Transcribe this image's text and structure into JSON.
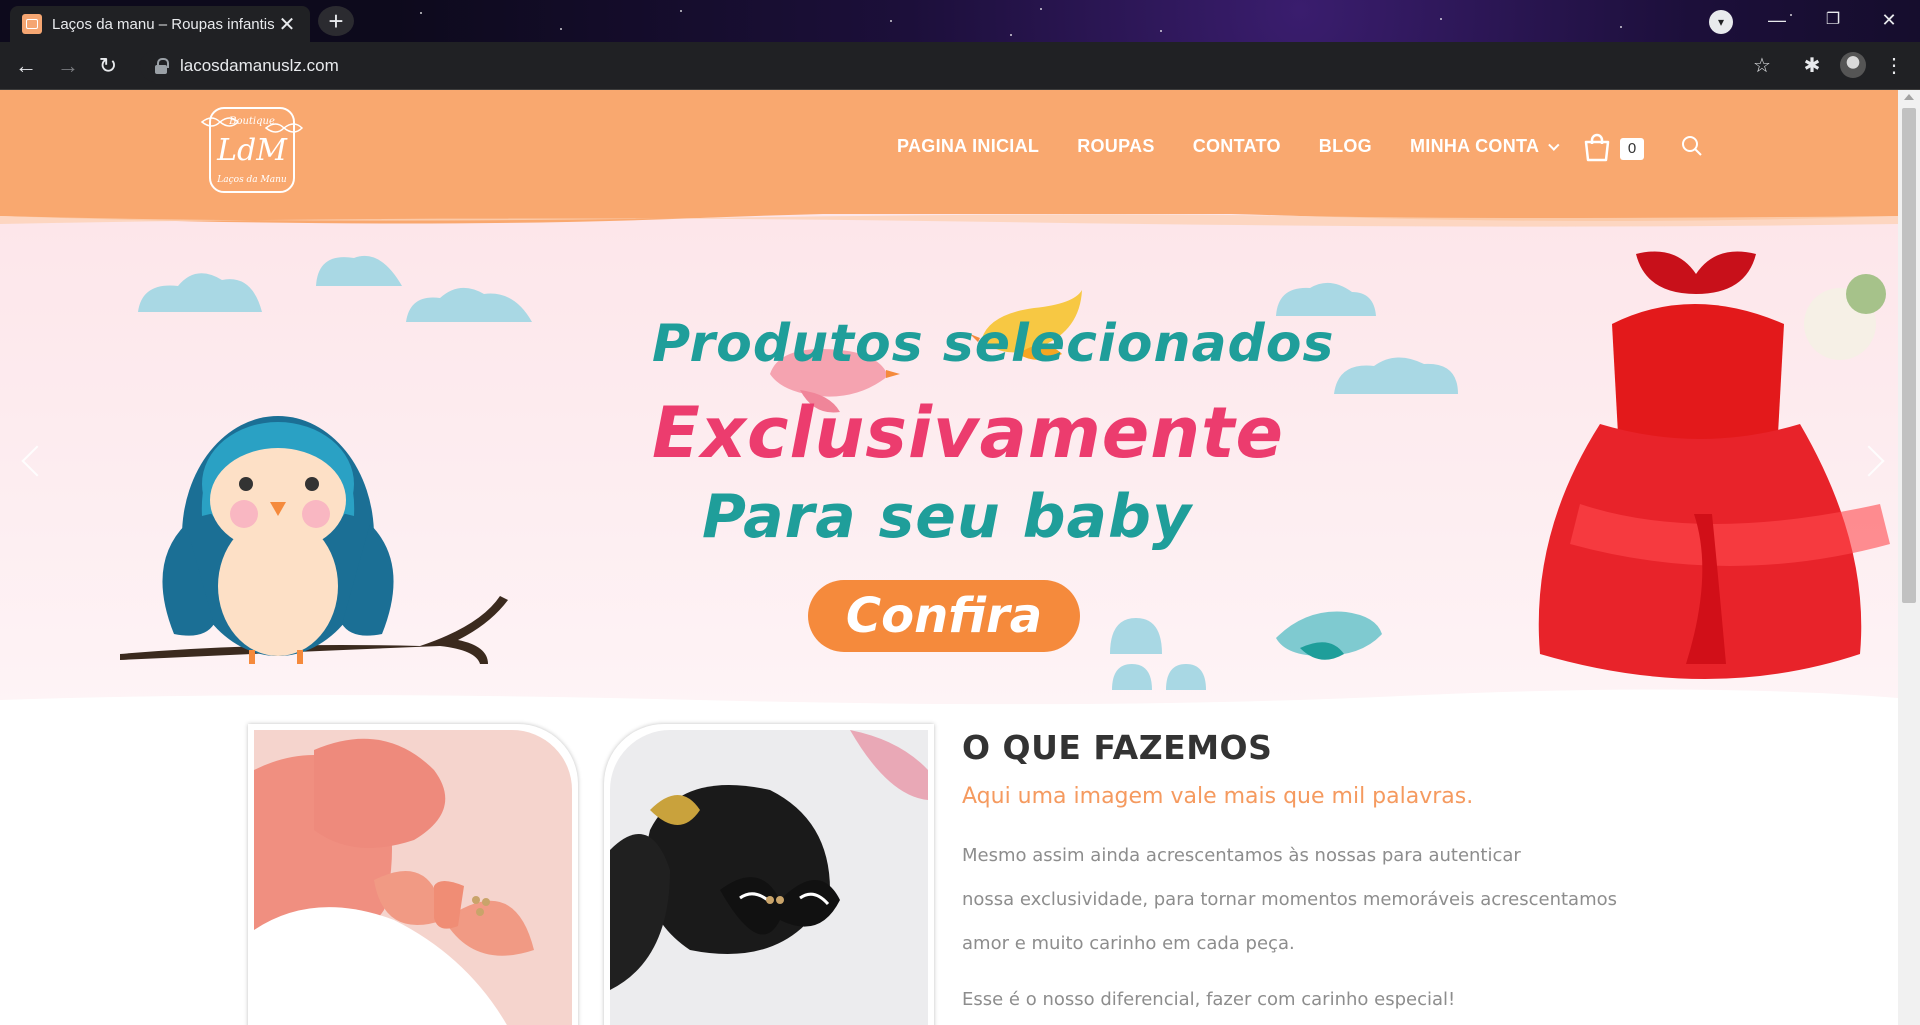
{
  "browser": {
    "tab_title": "Laços da manu – Roupas infantis",
    "tab_close": "✕",
    "new_tab": "+",
    "url": "lacosdamanuslz.com",
    "window_controls": {
      "minimize": "—",
      "restore": "❐",
      "close": "✕"
    }
  },
  "header": {
    "logo_text_top": "Boutique",
    "logo_monogram": "LdM",
    "logo_text_bottom": "Laços da Manu",
    "menu": [
      {
        "label": "PAGINA INICIAL"
      },
      {
        "label": "ROUPAS"
      },
      {
        "label": "CONTATO"
      },
      {
        "label": "BLOG"
      },
      {
        "label": "MINHA CONTA"
      }
    ],
    "cart_count": "0",
    "colors": {
      "header_bg": "#f9a86f",
      "menu_text": "#ffffff"
    }
  },
  "hero": {
    "line1": "Produtos selecionados",
    "line2": "Exclusivamente",
    "line3": "Para seu baby",
    "cta": "Confira",
    "colors": {
      "teal": "#1f9e9a",
      "pink": "#ec3c6e",
      "cta_bg": "#f58a3c"
    }
  },
  "about": {
    "title": "O QUE FAZEMOS",
    "subtitle": "Aqui uma imagem vale mais que mil palavras.",
    "paragraph_lines": [
      "Mesmo assim ainda acrescentamos às nossas para autenticar",
      "nossa exclusividade, para tornar momentos memoráveis acrescentamos",
      "amor e muito carinho em cada peça."
    ],
    "paragraph2": "Esse é o nosso diferencial, fazer com carinho especial!"
  }
}
